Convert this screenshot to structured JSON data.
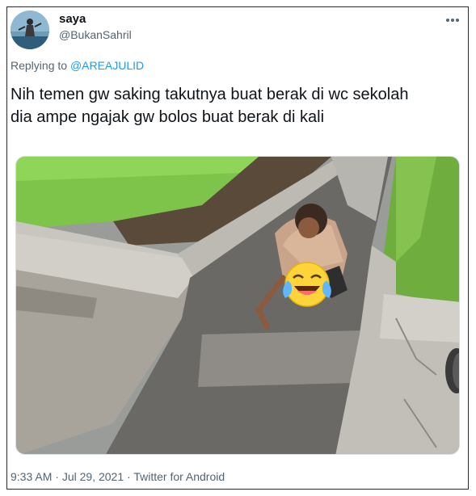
{
  "tweet": {
    "author_name": "saya",
    "author_handle": "@BukanSahril",
    "more_icon": "more-horizontal-icon",
    "reply_prefix": "Replying to ",
    "reply_mention": "@AREAJULID",
    "text_line1": "Nih temen gw saking takutnya buat berak di wc sekolah",
    "text_line2": "dia ampe ngajak gw bolos buat berak di kali",
    "time": "9:33 AM",
    "date": "Jul 29, 2021",
    "source": "Twitter for Android",
    "separator": " · "
  },
  "media": {
    "emoji_overlay": "face-with-tears-of-joy-icon"
  }
}
